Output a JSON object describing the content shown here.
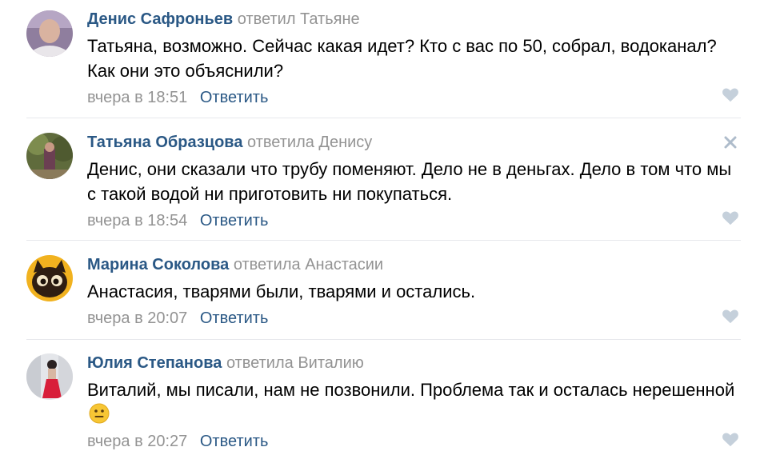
{
  "comments": [
    {
      "author": "Денис Сафроньев",
      "replied_to": "ответил Татьяне",
      "text": "Татьяна, возможно. Сейчас какая идет? Кто с вас по 50, собрал, водоканал? Как они это объяснили?",
      "time": "вчера в 18:51",
      "reply_label": "Ответить"
    },
    {
      "author": "Татьяна Образцова",
      "replied_to": "ответила Денису",
      "text": "Денис, они сказали что трубу поменяют. Дело не в деньгах. Дело в том что мы с такой водой ни приготовить ни покупаться.",
      "time": "вчера в 18:54",
      "reply_label": "Ответить"
    },
    {
      "author": "Марина Соколова",
      "replied_to": "ответила Анастасии",
      "text": "Анастасия, тварями были, тварями и остались.",
      "time": "вчера в 20:07",
      "reply_label": "Ответить"
    },
    {
      "author": "Юлия Степанова",
      "replied_to": "ответила Виталию",
      "text": "Виталий, мы писали, нам не позвонили. Проблема так и осталась нерешенной",
      "time": "вчера в 20:27",
      "reply_label": "Ответить"
    }
  ],
  "icons": {
    "like": "heart-icon",
    "delete": "close-icon",
    "emoji": "neutral-face-emoji"
  },
  "colors": {
    "author": "#2a5885",
    "secondary": "#939393",
    "divider": "#e7e8ec",
    "icon": "#c5d0db"
  }
}
